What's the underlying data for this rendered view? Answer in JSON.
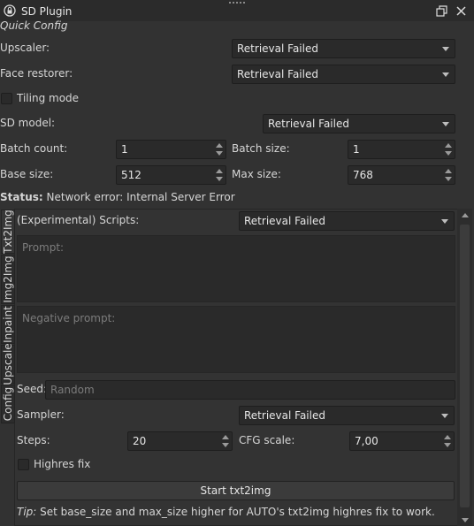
{
  "window": {
    "title": "SD Plugin",
    "icons": {
      "plugin": "lock-icon",
      "float": "float-window-icon",
      "close": "close-icon"
    }
  },
  "quick_config": {
    "heading": "Quick Config",
    "upscaler_label": "Upscaler:",
    "upscaler_value": "Retrieval Failed",
    "face_restorer_label": "Face restorer:",
    "face_restorer_value": "Retrieval Failed",
    "tiling_label": "Tiling mode",
    "tiling_checked": false,
    "sd_model_label": "SD model:",
    "sd_model_value": "Retrieval Failed",
    "batch_count_label": "Batch count:",
    "batch_count_value": "1",
    "batch_size_label": "Batch size:",
    "batch_size_value": "1",
    "base_size_label": "Base size:",
    "base_size_value": "512",
    "max_size_label": "Max size:",
    "max_size_value": "768",
    "status_label": "Status:",
    "status_text": "Network error: Internal Server Error"
  },
  "tabs": [
    "Txt2Img",
    "Img2Img",
    "Inpaint",
    "Upscale",
    "Config"
  ],
  "active_tab": "Txt2Img",
  "txt2img": {
    "scripts_label": "(Experimental) Scripts:",
    "scripts_value": "Retrieval Failed",
    "prompt_placeholder": "Prompt:",
    "negative_prompt_placeholder": "Negative prompt:",
    "seed_label": "Seed:",
    "seed_placeholder": "Random",
    "sampler_label": "Sampler:",
    "sampler_value": "Retrieval Failed",
    "steps_label": "Steps:",
    "steps_value": "20",
    "cfg_label": "CFG scale:",
    "cfg_value": "7,00",
    "highres_label": "Highres fix",
    "highres_checked": false,
    "start_button": "Start txt2img",
    "tip_label": "Tip:",
    "tip_text": "Set base_size and max_size higher for AUTO's txt2img highres fix to work."
  },
  "colors": {
    "background": "#323232",
    "input": "#2a2a2a",
    "titlebar": "#2b2b2b",
    "text": "#d6d6d6",
    "placeholder": "#7c7c7c"
  }
}
